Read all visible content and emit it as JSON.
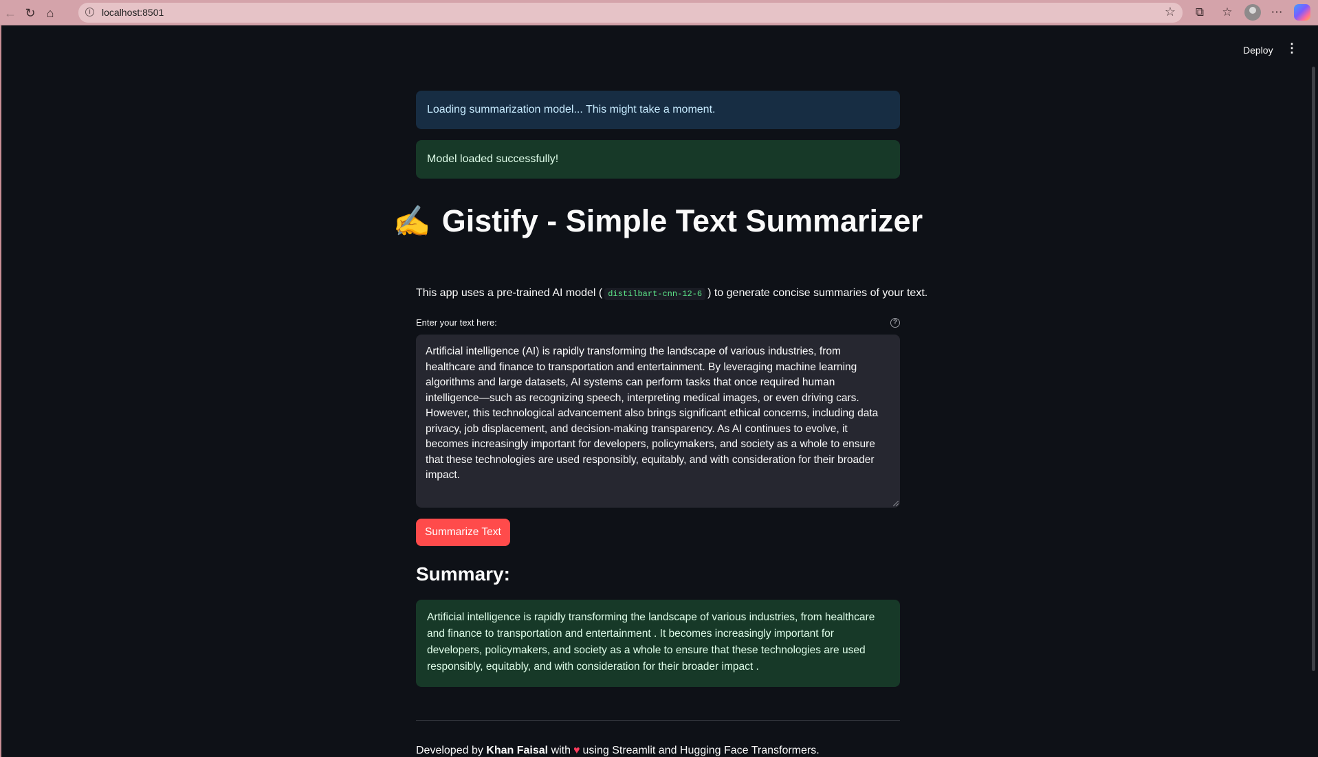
{
  "browser": {
    "url": "localhost:8501"
  },
  "header": {
    "deploy_label": "Deploy",
    "menu_icon": "kebab-menu-icon"
  },
  "alerts": {
    "info": "Loading summarization model... This might take a moment.",
    "success": "Model loaded successfully!"
  },
  "title": {
    "emoji": "✍️",
    "text": "Gistify - Simple Text Summarizer"
  },
  "intro": {
    "before": "This app uses a pre-trained AI model (",
    "model": "distilbart-cnn-12-6",
    "after": ") to generate concise summaries of your text."
  },
  "input": {
    "label": "Enter your text here:",
    "value": "Artificial intelligence (AI) is rapidly transforming the landscape of various industries, from healthcare and finance to transportation and entertainment. By leveraging machine learning algorithms and large datasets, AI systems can perform tasks that once required human intelligence—such as recognizing speech, interpreting medical images, or even driving cars. However, this technological advancement also brings significant ethical concerns, including data privacy, job displacement, and decision-making transparency. As AI continues to evolve, it becomes increasingly important for developers, policymakers, and society as a whole to ensure that these technologies are used responsibly, equitably, and with consideration for their broader impact."
  },
  "actions": {
    "summarize_label": "Summarize Text"
  },
  "summary": {
    "heading": "Summary:",
    "text": "Artificial intelligence is rapidly transforming the landscape of various industries, from healthcare and finance to transportation and entertainment . It becomes increasingly important for developers, policymakers, and society as a whole to ensure that these technologies are used responsibly, equitably, and with consideration for their broader impact ."
  },
  "footer": {
    "prefix": "Developed by",
    "author": "Khan Faisal",
    "with": "with",
    "suffix": "using Streamlit and Hugging Face Transformers."
  },
  "colors": {
    "background": "#0e1117",
    "info_bg": "#172d43",
    "success_bg": "#173928",
    "primary_button": "#ff4b4b",
    "code_text": "#5ce488"
  }
}
